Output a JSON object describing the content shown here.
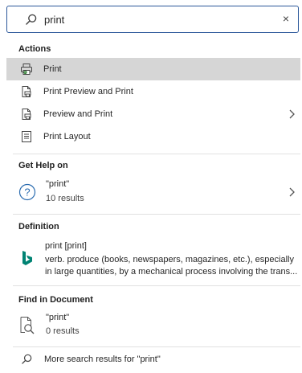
{
  "search": {
    "query": "print",
    "clear_label": "×"
  },
  "actions": {
    "header": "Actions",
    "items": [
      {
        "label": "Print",
        "icon": "printer-icon"
      },
      {
        "label": "Print Preview and Print",
        "icon": "print-preview-icon"
      },
      {
        "label": "Preview and Print",
        "icon": "preview-print-icon"
      },
      {
        "label": "Print Layout",
        "icon": "print-layout-icon"
      }
    ]
  },
  "help": {
    "header": "Get Help on",
    "query": "\"print\"",
    "count": "10 results"
  },
  "definition": {
    "header": "Definition",
    "term": "print [print]",
    "line1": "verb. produce (books, newspapers, magazines, etc.), especially",
    "line2": "in large quantities, by a mechanical process involving the trans..."
  },
  "find": {
    "header": "Find in Document",
    "query": "\"print\"",
    "count": "0 results"
  },
  "more": {
    "label": "More search results for \"print\""
  },
  "colors": {
    "accent": "#2b579a",
    "bing": "#008373",
    "hover": "#d6d6d6"
  }
}
